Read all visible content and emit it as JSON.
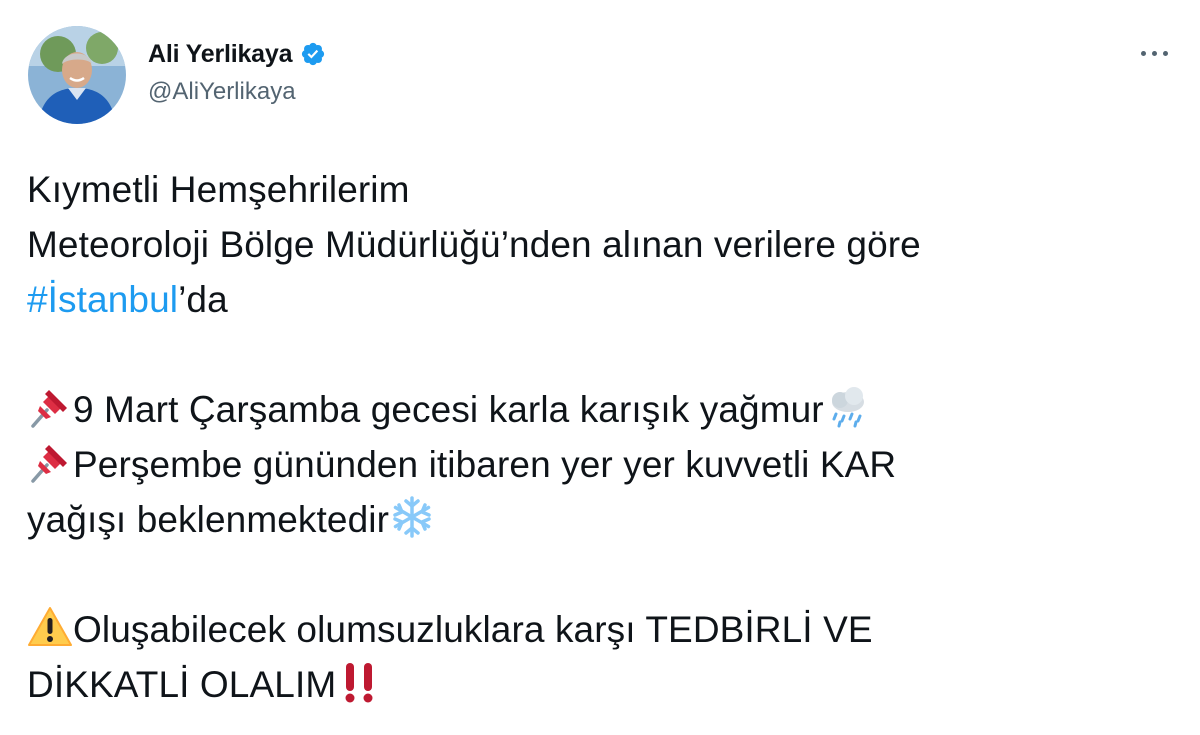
{
  "author": {
    "display_name": "Ali Yerlikaya",
    "handle": "@AliYerlikaya",
    "verified": true
  },
  "tweet": {
    "line1": "Kıymetli Hemşehrilerim",
    "line2": "Meteoroloji Bölge Müdürlüğü’nden alınan verilere göre",
    "line3_hashtag": "#İstanbul",
    "line3_rest": "’da",
    "line4": "9 Mart Çarşamba gecesi karla karışık yağmur",
    "line5": "Perşembe gününden itibaren yer yer kuvvetli KAR",
    "line6": "yağışı beklenmektedir",
    "line7": "Oluşabilecek olumsuzluklara karşı TEDBİRLİ VE",
    "line8": "DİKKATLİ OLALIM"
  },
  "icons": {
    "verified": "verified-badge-icon",
    "more": "more-options-icon",
    "pin": "pushpin-emoji",
    "rain": "cloud-with-rain-emoji",
    "snow": "snowflake-emoji",
    "warning": "warning-emoji",
    "alert": "double-exclamation-emoji"
  },
  "colors": {
    "hashtag": "#1d9bf0",
    "verified": "#1d9bf0",
    "text": "#0f1419",
    "secondary": "#536471"
  }
}
